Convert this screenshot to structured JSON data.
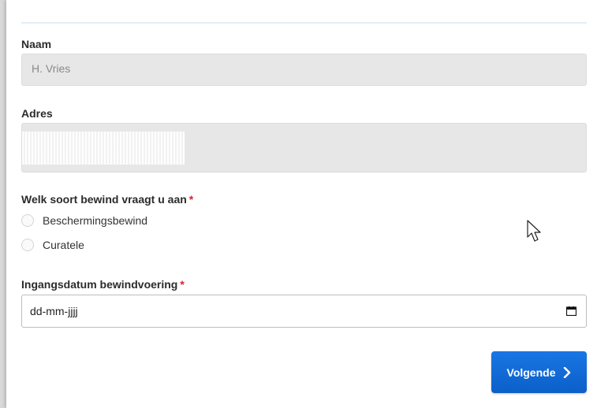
{
  "form": {
    "name": {
      "label": "Naam",
      "value": "H. Vries"
    },
    "address": {
      "label": "Adres",
      "value": ""
    },
    "bewind_type": {
      "label": "Welk soort bewind vraagt u aan",
      "required_mark": "*",
      "options": [
        {
          "label": "Beschermingsbewind",
          "selected": false
        },
        {
          "label": "Curatele",
          "selected": false
        }
      ]
    },
    "start_date": {
      "label": "Ingangsdatum bewindvoering",
      "required_mark": "*",
      "placeholder": "dd-mm-jjjj",
      "icon": "calendar-icon"
    },
    "next_button": {
      "label": "Volgende",
      "icon": "chevron-right-icon",
      "color": "#1371dc"
    }
  },
  "colors": {
    "required": "#d9232d",
    "readonly_bg": "#e7e7e7"
  },
  "cursor": {
    "icon": "mouse-pointer-icon"
  }
}
